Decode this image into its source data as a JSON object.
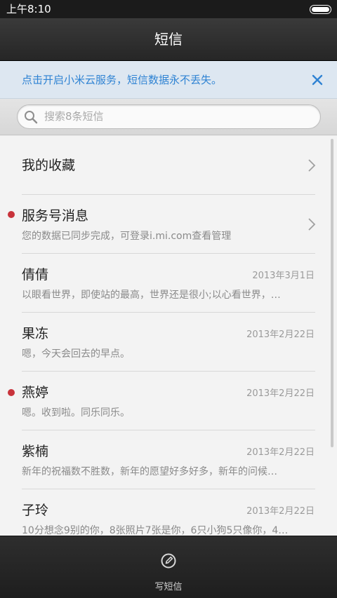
{
  "status_bar": {
    "time": "上午8:10"
  },
  "title_bar": {
    "title": "短信"
  },
  "banner": {
    "text": "点击开启小米云服务，短信数据永不丢失。",
    "accent_color": "#2f83d3"
  },
  "search": {
    "placeholder": "搜索8条短信"
  },
  "list": {
    "favorites": {
      "title": "我的收藏"
    },
    "service": {
      "title": "服务号消息",
      "preview": "您的数据已同步完成，可登录i.mi.com查看管理",
      "unread": true
    },
    "conversations": [
      {
        "name": "倩倩",
        "date": "2013年3月1日",
        "preview": "以眼看世界，即使站的最高，世界还是很小;以心看世界，…",
        "unread": false
      },
      {
        "name": "果冻",
        "date": "2013年2月22日",
        "preview": "嗯，今天会回去的早点。",
        "unread": false
      },
      {
        "name": "燕婷",
        "date": "2013年2月22日",
        "preview": "嗯。收到啦。同乐同乐。",
        "unread": true
      },
      {
        "name": "紫楠",
        "date": "2013年2月22日",
        "preview": "新年的祝福数不胜数，新年的愿望好多好多，新年的问候…",
        "unread": false
      },
      {
        "name": "子玲",
        "date": "2013年2月22日",
        "preview": "10分想念9别的你，8张照片7张是你，6只小狗5只像你，4…",
        "unread": false
      }
    ]
  },
  "toolbar": {
    "compose_label": "写短信",
    "compose_icon": "compose-icon"
  },
  "colors": {
    "unread_dot": "#c8333b"
  }
}
